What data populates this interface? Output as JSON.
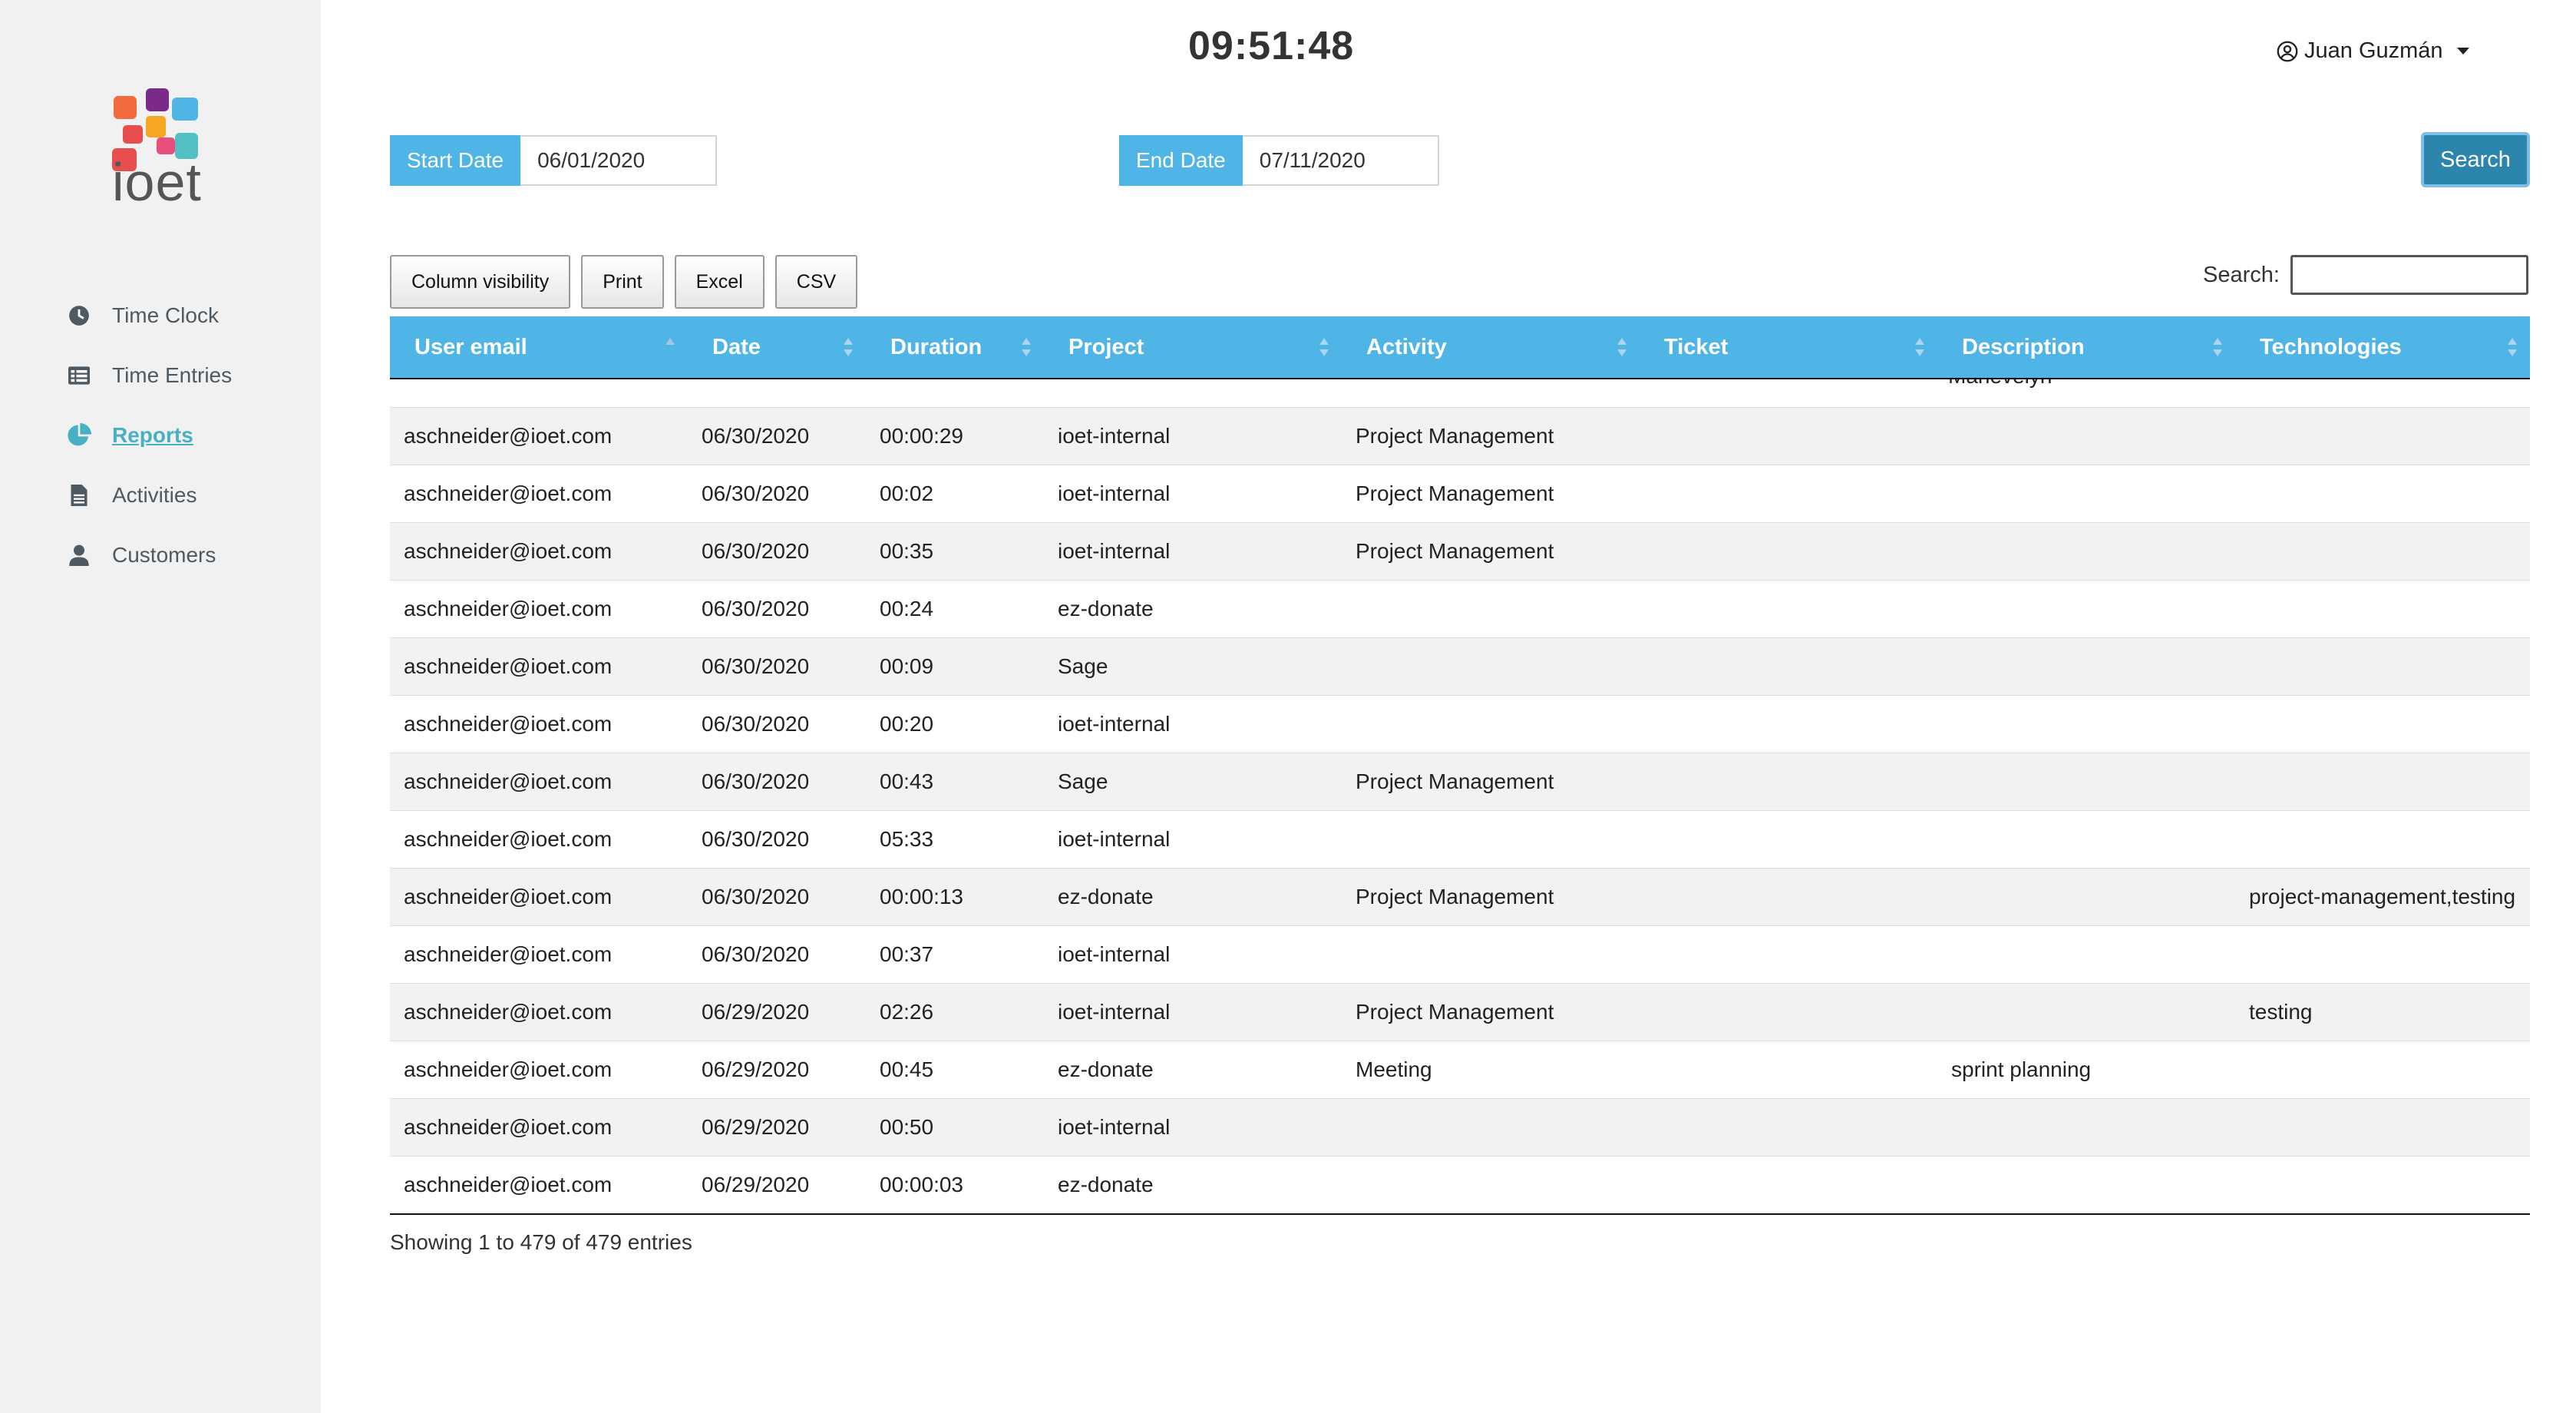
{
  "sidebar": {
    "logo_text": "ioet",
    "items": [
      {
        "label": "Time Clock",
        "icon": "clock-icon",
        "active": false
      },
      {
        "label": "Time Entries",
        "icon": "list-icon",
        "active": false
      },
      {
        "label": "Reports",
        "icon": "pie-chart-icon",
        "active": true
      },
      {
        "label": "Activities",
        "icon": "file-icon",
        "active": false
      },
      {
        "label": "Customers",
        "icon": "user-icon",
        "active": false
      }
    ]
  },
  "header": {
    "clock": "09:51:48",
    "user_name": "Juan Guzmán"
  },
  "filters": {
    "start_label": "Start Date",
    "start_value": "06/01/2020",
    "end_label": "End Date",
    "end_value": "07/11/2020",
    "search_button": "Search"
  },
  "toolbar": {
    "buttons": [
      "Column visibility",
      "Print",
      "Excel",
      "CSV"
    ],
    "search_label": "Search:"
  },
  "colors": {
    "header_bg": "#4fb4e6",
    "accent": "#47b1c3",
    "search_button": "#2c85ad"
  },
  "table": {
    "columns": [
      "User email",
      "Date",
      "Duration",
      "Project",
      "Activity",
      "Ticket",
      "Description",
      "Technologies"
    ],
    "partial_cell": "Manevelyn",
    "rows": [
      [
        "aschneider@ioet.com",
        "06/30/2020",
        "00:00:29",
        "ioet-internal",
        "Project Management",
        "",
        "",
        ""
      ],
      [
        "aschneider@ioet.com",
        "06/30/2020",
        "00:02",
        "ioet-internal",
        "Project Management",
        "",
        "",
        ""
      ],
      [
        "aschneider@ioet.com",
        "06/30/2020",
        "00:35",
        "ioet-internal",
        "Project Management",
        "",
        "",
        ""
      ],
      [
        "aschneider@ioet.com",
        "06/30/2020",
        "00:24",
        "ez-donate",
        "",
        "",
        "",
        ""
      ],
      [
        "aschneider@ioet.com",
        "06/30/2020",
        "00:09",
        "Sage",
        "",
        "",
        "",
        ""
      ],
      [
        "aschneider@ioet.com",
        "06/30/2020",
        "00:20",
        "ioet-internal",
        "",
        "",
        "",
        ""
      ],
      [
        "aschneider@ioet.com",
        "06/30/2020",
        "00:43",
        "Sage",
        "Project Management",
        "",
        "",
        ""
      ],
      [
        "aschneider@ioet.com",
        "06/30/2020",
        "05:33",
        "ioet-internal",
        "",
        "",
        "",
        ""
      ],
      [
        "aschneider@ioet.com",
        "06/30/2020",
        "00:00:13",
        "ez-donate",
        "Project Management",
        "",
        "",
        "project-management,testing"
      ],
      [
        "aschneider@ioet.com",
        "06/30/2020",
        "00:37",
        "ioet-internal",
        "",
        "",
        "",
        ""
      ],
      [
        "aschneider@ioet.com",
        "06/29/2020",
        "02:26",
        "ioet-internal",
        "Project Management",
        "",
        "",
        "testing"
      ],
      [
        "aschneider@ioet.com",
        "06/29/2020",
        "00:45",
        "ez-donate",
        "Meeting",
        "",
        "sprint planning",
        ""
      ],
      [
        "aschneider@ioet.com",
        "06/29/2020",
        "00:50",
        "ioet-internal",
        "",
        "",
        "",
        ""
      ],
      [
        "aschneider@ioet.com",
        "06/29/2020",
        "00:00:03",
        "ez-donate",
        "",
        "",
        "",
        ""
      ]
    ]
  },
  "footer": {
    "info": "Showing 1 to 479 of 479 entries"
  }
}
